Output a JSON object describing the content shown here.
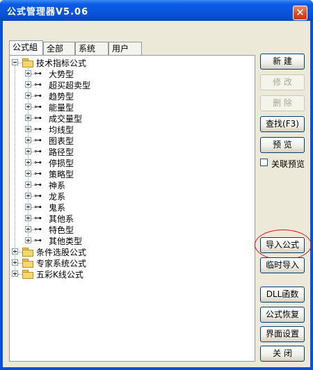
{
  "window": {
    "title": "公式管理器V5.06",
    "close_glyph": "✕"
  },
  "tabs": [
    "公式組",
    "全部",
    "系统",
    "用户"
  ],
  "tree": {
    "root_items": [
      {
        "label": "技术指标公式",
        "expanded": true,
        "children": [
          "大势型",
          "超买超卖型",
          "趋势型",
          "能量型",
          "成交量型",
          "均线型",
          "图表型",
          "路径型",
          "停损型",
          "策略型",
          "神系",
          "龙系",
          "鬼系",
          "其他系",
          "特色型",
          "其他类型"
        ]
      },
      {
        "label": "条件选股公式",
        "expanded": false
      },
      {
        "label": "专家系统公式",
        "expanded": false
      },
      {
        "label": "五彩K线公式",
        "expanded": false
      }
    ],
    "key_glyph": "⊶"
  },
  "buttons": {
    "new": "新  建",
    "modify": "修  改",
    "delete": "删  除",
    "find": "查找(F3)",
    "preview": "预  览",
    "import": "导入公式",
    "temp_import": "临时导入",
    "dll": "DLL函数",
    "restore": "公式恢复",
    "ui_settings": "界面设置",
    "close": "关  闭"
  },
  "linked_preview": {
    "label": "关联预览",
    "checked": false
  },
  "highlight_color": "#d3131b"
}
